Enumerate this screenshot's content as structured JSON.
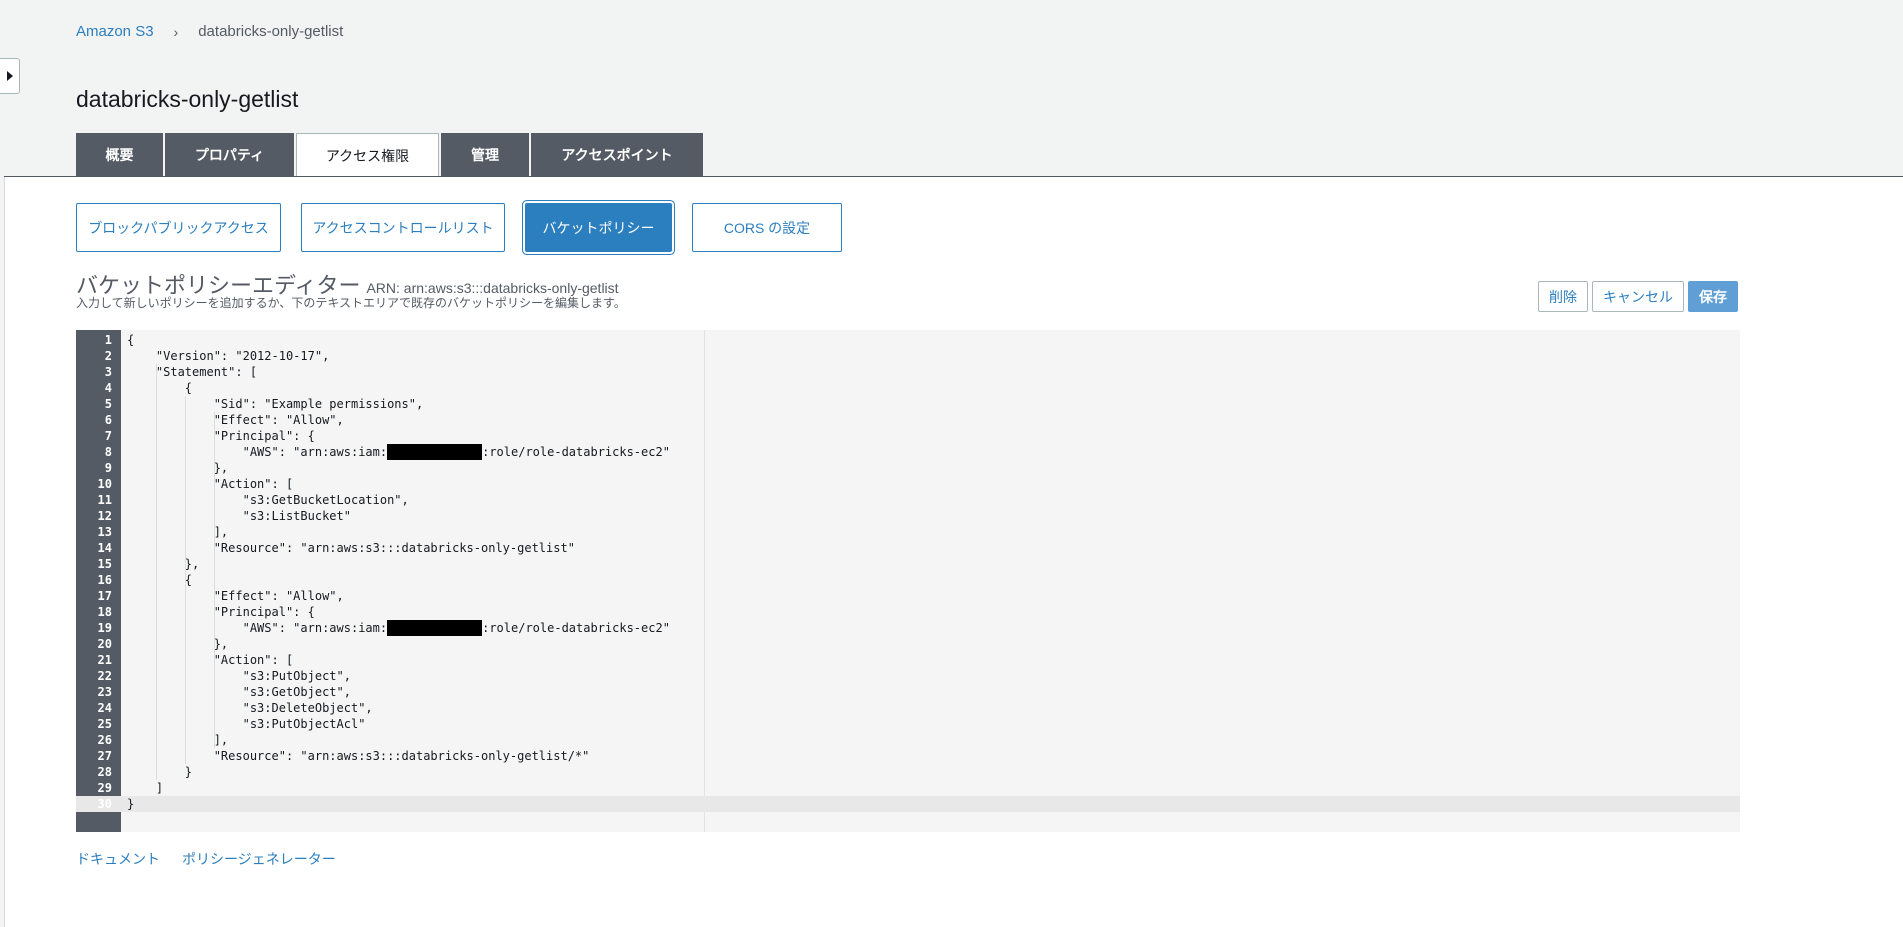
{
  "breadcrumb": {
    "root": "Amazon S3",
    "current": "databricks-only-getlist",
    "separator": "›"
  },
  "page_title": "databricks-only-getlist",
  "tabs": [
    {
      "label": "概要"
    },
    {
      "label": "プロパティ"
    },
    {
      "label": "アクセス権限",
      "active": true
    },
    {
      "label": "管理"
    },
    {
      "label": "アクセスポイント"
    }
  ],
  "subnav": [
    {
      "label": "ブロックパブリックアクセス"
    },
    {
      "label": "アクセスコントロールリスト"
    },
    {
      "label": "バケットポリシー",
      "active": true
    },
    {
      "label": "CORS の設定"
    }
  ],
  "editor": {
    "title": "バケットポリシーエディター",
    "arn": "ARN: arn:aws:s3:::databricks-only-getlist",
    "description": "入力して新しいポリシーを追加するか、下のテキストエリアで既存のバケットポリシーを編集します。",
    "delete_label": "削除",
    "cancel_label": "キャンセル",
    "save_label": "保存",
    "lines": [
      "{",
      "    \"Version\": \"2012-10-17\",",
      "    \"Statement\": [",
      "        {",
      "            \"Sid\": \"Example permissions\",",
      "            \"Effect\": \"Allow\",",
      "            \"Principal\": {",
      "                \"AWS\": \"arn:aws:iam:[REDACTED]:role/role-databricks-ec2\"",
      "            },",
      "            \"Action\": [",
      "                \"s3:GetBucketLocation\",",
      "                \"s3:ListBucket\"",
      "            ],",
      "            \"Resource\": \"arn:aws:s3:::databricks-only-getlist\"",
      "        },",
      "        {",
      "            \"Effect\": \"Allow\",",
      "            \"Principal\": {",
      "                \"AWS\": \"arn:aws:iam:[REDACTED]:role/role-databricks-ec2\"",
      "            },",
      "            \"Action\": [",
      "                \"s3:PutObject\",",
      "                \"s3:GetObject\",",
      "                \"s3:DeleteObject\",",
      "                \"s3:PutObjectAcl\"",
      "            ],",
      "            \"Resource\": \"arn:aws:s3:::databricks-only-getlist/*\"",
      "        }",
      "    ]",
      "}"
    ],
    "current_line": 30
  },
  "links": {
    "docs": "ドキュメント",
    "generator": "ポリシージェネレーター"
  }
}
